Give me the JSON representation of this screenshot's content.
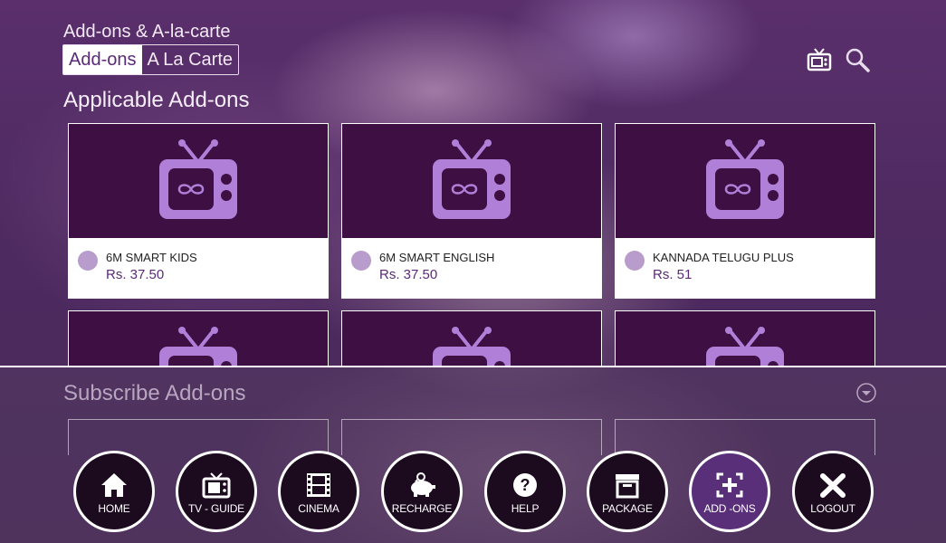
{
  "header": {
    "title": "Add-ons & A-la-carte",
    "tabs": [
      {
        "label": "Add-ons",
        "active": true
      },
      {
        "label": "A La Carte",
        "active": false
      }
    ],
    "icons": [
      "tv-icon",
      "search-icon"
    ]
  },
  "applicable": {
    "title": "Applicable Add-ons",
    "cards": [
      {
        "name": "6M SMART KIDS",
        "price": "Rs. 37.50"
      },
      {
        "name": "6M SMART ENGLISH",
        "price": "Rs. 37.50"
      },
      {
        "name": "KANNADA TELUGU PLUS",
        "price": "Rs. 51"
      }
    ]
  },
  "subscribe": {
    "title": "Subscribe Add-ons"
  },
  "nav": {
    "items": [
      {
        "label": "HOME",
        "icon": "home-icon"
      },
      {
        "label": "TV - GUIDE",
        "icon": "tv-guide-icon"
      },
      {
        "label": "CINEMA",
        "icon": "film-icon"
      },
      {
        "label": "RECHARGE",
        "icon": "piggy-bank-icon"
      },
      {
        "label": "HELP",
        "icon": "help-icon"
      },
      {
        "label": "PACKAGE",
        "icon": "package-icon"
      },
      {
        "label": "ADD -ONS",
        "icon": "add-ons-icon",
        "active": true
      },
      {
        "label": "LOGOUT",
        "icon": "logout-icon"
      }
    ]
  },
  "colors": {
    "accent": "#5a2a78",
    "thumb_bg": "#3d0f43",
    "tv_icon": "#b07fd8",
    "dot": "#b79ccc"
  }
}
